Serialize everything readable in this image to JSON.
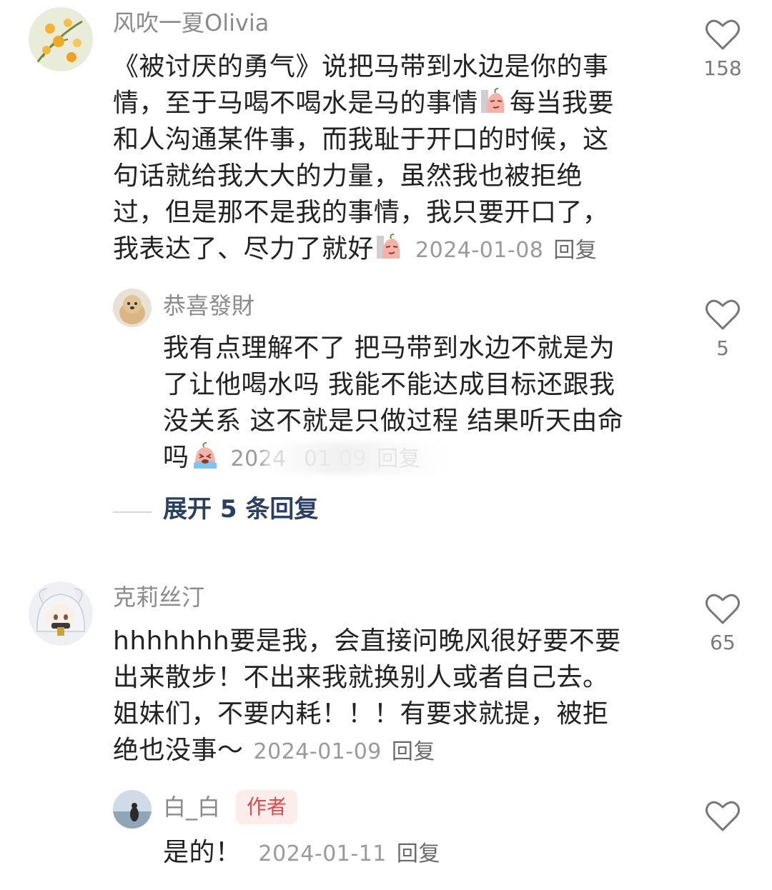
{
  "comments": [
    {
      "username": "风吹一夏Olivia",
      "text_lines": [
        "《被讨厌的勇气》说把马带到水边是你的事",
        "情，至于马喝不喝水是马的事情",
        "每当我要",
        "和人沟通某件事，而我耻于开口的时候，这",
        "句话就给我大大的力量，虽然我也被拒绝",
        "过，但是那不是我的事情，我只要开口了，",
        "我表达了、尽力了就好"
      ],
      "date": "2024-01-08",
      "reply_label": "回复",
      "likes": "158",
      "avatar_icon": "flower-avatar"
    },
    {
      "username": "恭喜發財",
      "text_lines": [
        "我有点理解不了 把马带到水边不就是为",
        "了让他喝水吗 我能不能达成目标还跟我",
        "没关系 这不就是只做过程 结果听天由命",
        "吗"
      ],
      "date": "2024",
      "reply_label": "回复",
      "likes": "5",
      "avatar_icon": "dog-avatar"
    },
    {
      "username": "克莉丝汀",
      "text_lines": [
        "hhhhhhh要是我，会直接问晚风很好要不要",
        "出来散步！不出来我就换别人或者自己去。",
        "姐妹们，不要内耗！！！有要求就提，被拒",
        "绝也没事～"
      ],
      "date": "2024-01-09",
      "reply_label": "回复",
      "likes": "65",
      "avatar_icon": "anime-avatar"
    },
    {
      "username": "白_白",
      "badge": "作者",
      "text_lines": [
        "是的！"
      ],
      "date": "2024-01-11",
      "reply_label": "回复",
      "avatar_icon": "seaside-avatar"
    }
  ],
  "expand_replies": "展开 5 条回复",
  "colors": {
    "username": "#8a8a8a",
    "text": "#222222",
    "meta": "#9a9a9a",
    "expand": "#2b3f63",
    "badge_bg": "#fdecec",
    "badge_text": "#e04a4a"
  },
  "icons": {
    "like": "heart-outline-icon",
    "emoji_1": "sweet-potato-smirk-emoji",
    "emoji_2": "sweet-potato-cry-emoji"
  }
}
